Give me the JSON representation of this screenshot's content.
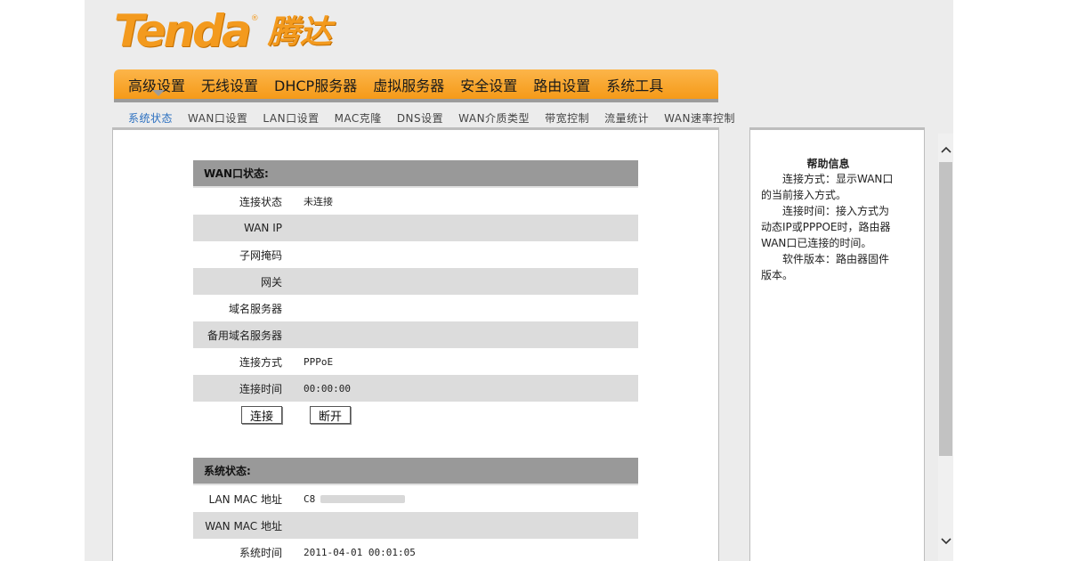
{
  "logo": {
    "text_en": "Tenda",
    "registered": "®",
    "text_cn": "腾达",
    "color": "#f39a1e"
  },
  "main_nav": {
    "items": [
      "高级设置",
      "无线设置",
      "DHCP服务器",
      "虚拟服务器",
      "安全设置",
      "路由设置",
      "系统工具"
    ]
  },
  "sub_nav": {
    "items": [
      "系统状态",
      "WAN口设置",
      "LAN口设置",
      "MAC克隆",
      "DNS设置",
      "WAN介质类型",
      "带宽控制",
      "流量统计",
      "WAN速率控制"
    ],
    "active_index": 0
  },
  "wan_status": {
    "title": "WAN口状态:",
    "rows": [
      {
        "label": "连接状态",
        "value": "未连接"
      },
      {
        "label": "WAN IP",
        "value": ""
      },
      {
        "label": "子网掩码",
        "value": ""
      },
      {
        "label": "网关",
        "value": ""
      },
      {
        "label": "域名服务器",
        "value": ""
      },
      {
        "label": "备用域名服务器",
        "value": ""
      },
      {
        "label": "连接方式",
        "value": "PPPoE"
      },
      {
        "label": "连接时间",
        "value": "00:00:00"
      }
    ],
    "connect_label": "连接",
    "disconnect_label": "断开"
  },
  "system_status": {
    "title": "系统状态:",
    "rows": [
      {
        "label": "LAN MAC 地址",
        "value": "C8"
      },
      {
        "label": "WAN MAC 地址",
        "value": ""
      },
      {
        "label": "系统时间",
        "value": "2011-04-01 00:01:05"
      }
    ]
  },
  "help": {
    "title": "帮助信息",
    "paragraphs": [
      "连接方式：显示WAN口的当前接入方式。",
      "连接时间：接入方式为动态IP或PPPOE时，路由器WAN口已连接的时间。",
      "软件版本：路由器固件版本。"
    ]
  },
  "scrollbar": {
    "up_icon": "chevron-up",
    "down_icon": "chevron-down"
  }
}
